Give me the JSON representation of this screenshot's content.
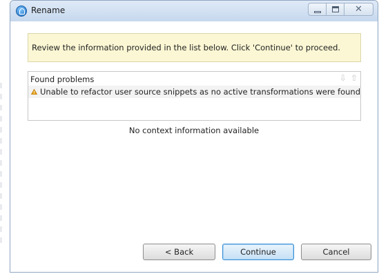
{
  "window": {
    "title": "Rename",
    "icon": "app-logo-icon",
    "controls": [
      "minimize-icon",
      "maximize-icon",
      "close-icon"
    ],
    "close_glyph": "✕"
  },
  "banner": {
    "message": "Review the information provided in the list below. Click 'Continue' to proceed.",
    "background_color": "#fbf7d4"
  },
  "problems": {
    "title": "Found problems",
    "nav_icons": [
      "arrow-down-icon",
      "arrow-up-icon"
    ],
    "nav_down_glyph": "⇩",
    "nav_up_glyph": "⇧",
    "items": [
      {
        "icon": "warning-icon",
        "text": "Unable to refactor user source snippets as no active transformations were found"
      }
    ]
  },
  "context": {
    "message": "No context information available"
  },
  "buttons": {
    "back": "< Back",
    "continue": "Continue",
    "cancel": "Cancel"
  },
  "colors": {
    "accent": "#3c8fd6",
    "warning": "#e8a21a"
  }
}
